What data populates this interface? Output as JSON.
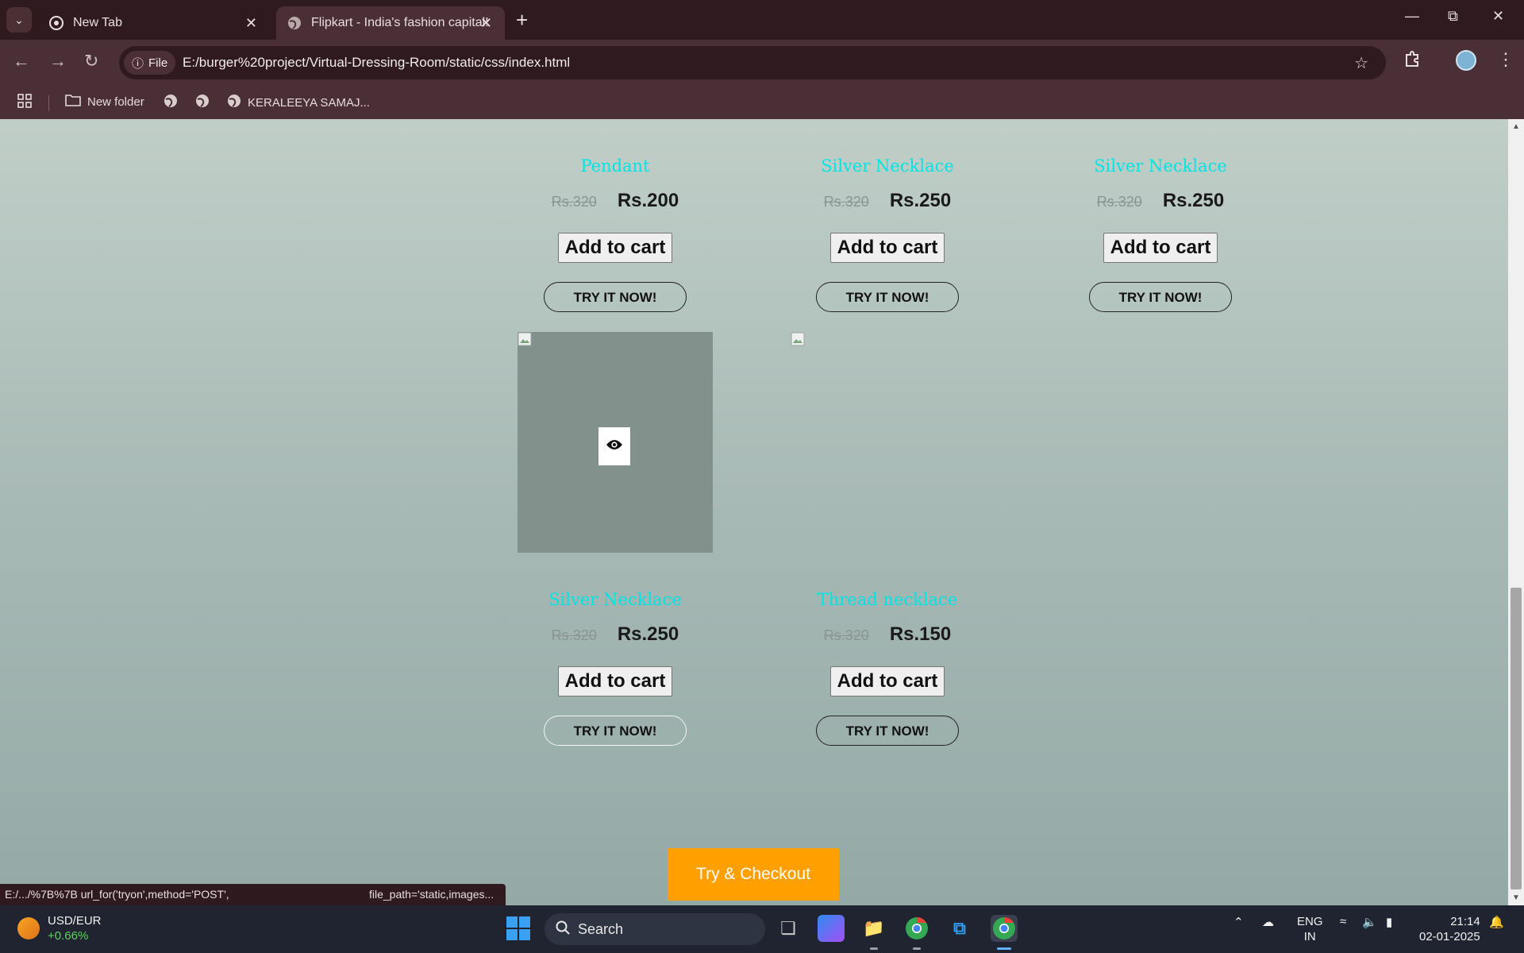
{
  "browser": {
    "tabs": [
      {
        "title": "New Tab",
        "active": false
      },
      {
        "title": "Flipkart - India's fashion capital!",
        "active": true
      }
    ],
    "site_chip": "File",
    "url": "E:/burger%20project/Virtual-Dressing-Room/static/css/index.html",
    "bookmarks": {
      "folder": "New folder",
      "named_site": "KERALEEYA SAMAJ..."
    },
    "status_left": "E:/.../%7B%7B url_for('tryon',method='POST',",
    "status_right": "file_path='static,images..."
  },
  "colors": {
    "product_name": "#00e5e5",
    "checkout": "#ff9f00",
    "chrome": "#4b2f36"
  },
  "products": [
    {
      "name": "Pendant",
      "old_price": "Rs.320",
      "price": "Rs.200",
      "cart": "Add to cart",
      "try": "TRY IT NOW!"
    },
    {
      "name": "Silver Necklace",
      "old_price": "Rs.320",
      "price": "Rs.250",
      "cart": "Add to cart",
      "try": "TRY IT NOW!"
    },
    {
      "name": "Silver Necklace",
      "old_price": "Rs.320",
      "price": "Rs.250",
      "cart": "Add to cart",
      "try": "TRY IT NOW!"
    },
    {
      "name": "Silver Necklace",
      "old_price": "Rs.320",
      "price": "Rs.250",
      "cart": "Add to cart",
      "try": "TRY IT NOW!"
    },
    {
      "name": "Thread necklace",
      "old_price": "Rs.320",
      "price": "Rs.150",
      "cart": "Add to cart",
      "try": "TRY IT NOW!"
    }
  ],
  "checkout_label": "Try & Checkout",
  "taskbar": {
    "widget_title": "USD/EUR",
    "widget_change": "+0.66%",
    "search": "Search",
    "lang_top": "ENG",
    "lang_bottom": "IN",
    "time": "21:14",
    "date": "02-01-2025"
  }
}
